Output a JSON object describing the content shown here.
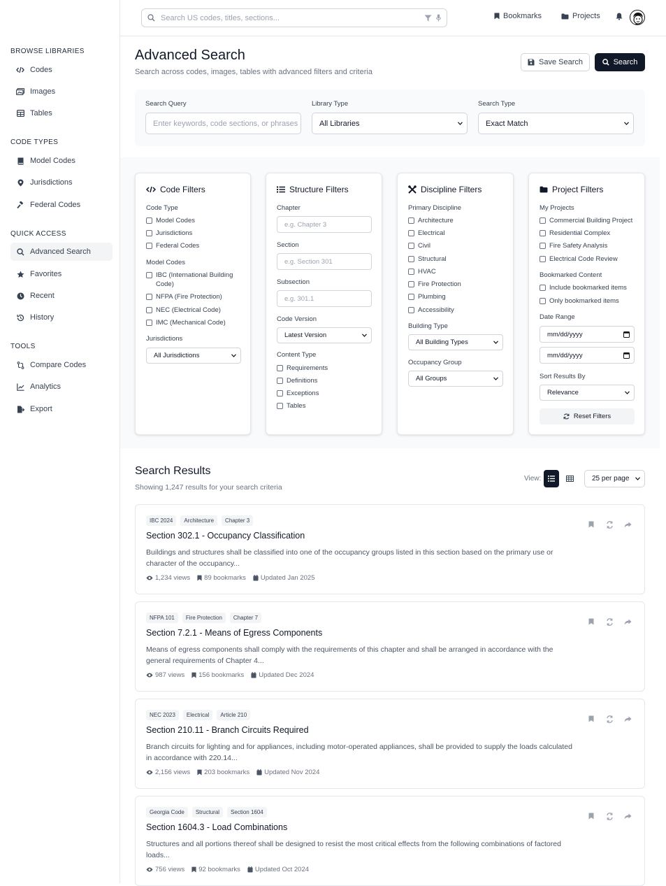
{
  "search": {
    "placeholder": "Search US codes, titles, sections..."
  },
  "topnav": {
    "bookmarks": "Bookmarks",
    "projects": "Projects"
  },
  "sidebar": {
    "sections": [
      {
        "title": "BROWSE LIBRARIES",
        "items": [
          {
            "label": "Codes",
            "icon": "code-icon"
          },
          {
            "label": "Images",
            "icon": "images-icon"
          },
          {
            "label": "Tables",
            "icon": "table-icon"
          }
        ]
      },
      {
        "title": "CODE TYPES",
        "items": [
          {
            "label": "Model Codes",
            "icon": "book-icon"
          },
          {
            "label": "Jurisdictions",
            "icon": "map-pin-icon"
          },
          {
            "label": "Federal Codes",
            "icon": "gavel-icon"
          }
        ]
      },
      {
        "title": "QUICK ACCESS",
        "items": [
          {
            "label": "Advanced Search",
            "icon": "search-icon"
          },
          {
            "label": "Favorites",
            "icon": "star-icon"
          },
          {
            "label": "Recent",
            "icon": "clock-icon"
          },
          {
            "label": "History",
            "icon": "history-icon"
          }
        ]
      },
      {
        "title": "TOOLS",
        "items": [
          {
            "label": "Compare Codes",
            "icon": "compare-icon"
          },
          {
            "label": "Analytics",
            "icon": "chart-line-icon"
          },
          {
            "label": "Export",
            "icon": "export-icon"
          }
        ]
      }
    ]
  },
  "header": {
    "title": "Advanced Search",
    "subtitle": "Search across codes, images, tables with advanced filters and criteria",
    "save_label": "Save Search",
    "search_label": "Search"
  },
  "query": {
    "search_query_label": "Search Query",
    "search_query_placeholder": "Enter keywords, code sections, or phrases",
    "library_type_label": "Library Type",
    "library_type_value": "All Libraries",
    "search_type_label": "Search Type",
    "search_type_value": "Exact Match"
  },
  "code_filters": {
    "title": "Code Filters",
    "code_type_label": "Code Type",
    "code_types": [
      "Model Codes",
      "Jurisdictions",
      "Federal Codes"
    ],
    "model_codes_label": "Model Codes",
    "model_codes": [
      "IBC (International Building Code)",
      "NFPA (Fire Protection)",
      "NEC (Electrical Code)",
      "IMC (Mechanical Code)"
    ],
    "jurisdictions_label": "Jurisdictions",
    "jurisdictions_value": "All Jurisdictions"
  },
  "structure_filters": {
    "title": "Structure Filters",
    "chapter_label": "Chapter",
    "chapter_placeholder": "e.g. Chapter 3",
    "section_label": "Section",
    "section_placeholder": "e.g. Section 301",
    "subsection_label": "Subsection",
    "subsection_placeholder": "e.g. 301.1",
    "version_label": "Code Version",
    "version_value": "Latest Version",
    "content_type_label": "Content Type",
    "content_types": [
      "Requirements",
      "Definitions",
      "Exceptions",
      "Tables"
    ]
  },
  "discipline_filters": {
    "title": "Discipline Filters",
    "primary_label": "Primary Discipline",
    "disciplines": [
      "Architecture",
      "Electrical",
      "Civil",
      "Structural",
      "HVAC",
      "Fire Protection",
      "Plumbing",
      "Accessibility"
    ],
    "building_type_label": "Building Type",
    "building_type_value": "All Building Types",
    "occupancy_label": "Occupancy Group",
    "occupancy_value": "All Groups"
  },
  "project_filters": {
    "title": "Project Filters",
    "my_projects_label": "My Projects",
    "projects": [
      "Commercial Building Project",
      "Residential Complex",
      "Fire Safety Analysis",
      "Electrical Code Review"
    ],
    "bookmarked_label": "Bookmarked Content",
    "bookmarked": [
      "Include bookmarked items",
      "Only bookmarked items"
    ],
    "date_range_label": "Date Range",
    "date_from": "mm/dd/yyyy",
    "date_to": "mm/dd/yyyy",
    "sort_label": "Sort Results By",
    "sort_value": "Relevance",
    "reset_label": "Reset Filters"
  },
  "results": {
    "title": "Search Results",
    "summary": "Showing 1,247 results for your search criteria",
    "view_label": "View:",
    "per_page": "25 per page",
    "items": [
      {
        "tags": [
          "IBC 2024",
          "Architecture",
          "Chapter 3"
        ],
        "title": "Section 302.1 - Occupancy Classification",
        "desc": "Buildings and structures shall be classified into one of the occupancy groups listed in this section based on the primary use or character of the occupancy...",
        "views": "1,234 views",
        "bookmarks": "89 bookmarks",
        "updated": "Updated Jan 2025"
      },
      {
        "tags": [
          "NFPA 101",
          "Fire Protection",
          "Chapter 7"
        ],
        "title": "Section 7.2.1 - Means of Egress Components",
        "desc": "Means of egress components shall comply with the requirements of this chapter and shall be arranged in accordance with the general requirements of Chapter 4...",
        "views": "987 views",
        "bookmarks": "156 bookmarks",
        "updated": "Updated Dec 2024"
      },
      {
        "tags": [
          "NEC 2023",
          "Electrical",
          "Article 210"
        ],
        "title": "Section 210.11 - Branch Circuits Required",
        "desc": "Branch circuits for lighting and for appliances, including motor-operated appliances, shall be provided to supply the loads calculated in accordance with 220.14...",
        "views": "2,156 views",
        "bookmarks": "203 bookmarks",
        "updated": "Updated Nov 2024"
      },
      {
        "tags": [
          "Georgia Code",
          "Structural",
          "Section 1604"
        ],
        "title": "Section 1604.3 - Load Combinations",
        "desc": "Structures and all portions thereof shall be designed to resist the most critical effects from the following combinations of factored loads...",
        "views": "756 views",
        "bookmarks": "92 bookmarks",
        "updated": "Updated Oct 2024"
      }
    ]
  }
}
